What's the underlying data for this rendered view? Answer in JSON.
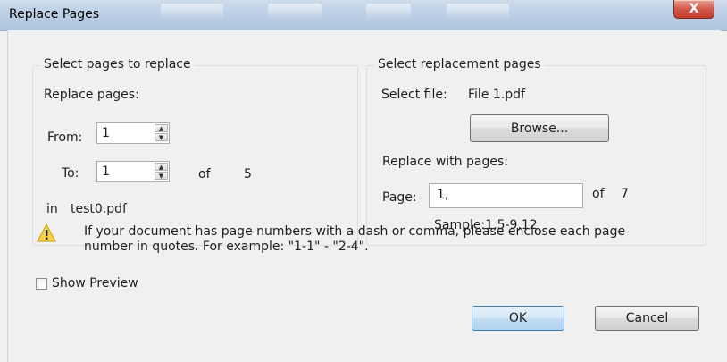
{
  "window": {
    "title": "Replace Pages",
    "close_label": "X"
  },
  "left_group": {
    "legend": "Select pages  to replace",
    "replace_pages_label": "Replace pages:",
    "from_label": "From:",
    "from_value": "1",
    "to_label": "To:",
    "to_value": "1",
    "of_label": "of",
    "total_pages": "5",
    "in_label": "in",
    "file_name": "test0.pdf"
  },
  "right_group": {
    "legend": "Select replacement pages",
    "select_file_label": "Select file:",
    "selected_file": "File 1.pdf",
    "browse_label": "Browse...",
    "replace_with_label": "Replace with pages:",
    "page_label": "Page:",
    "page_value": "1,",
    "of_label": "of",
    "total_pages": "7",
    "sample_text": "Sample:1,5-9,12"
  },
  "warning": {
    "line1": "If your document has page numbers with a dash or comma, please enclose each page",
    "line2": "number in quotes. For example: \"1-1\" - \"2-4\"."
  },
  "footer": {
    "show_preview_label": "Show Preview",
    "show_preview_checked": false,
    "ok_label": "OK",
    "cancel_label": "Cancel"
  }
}
